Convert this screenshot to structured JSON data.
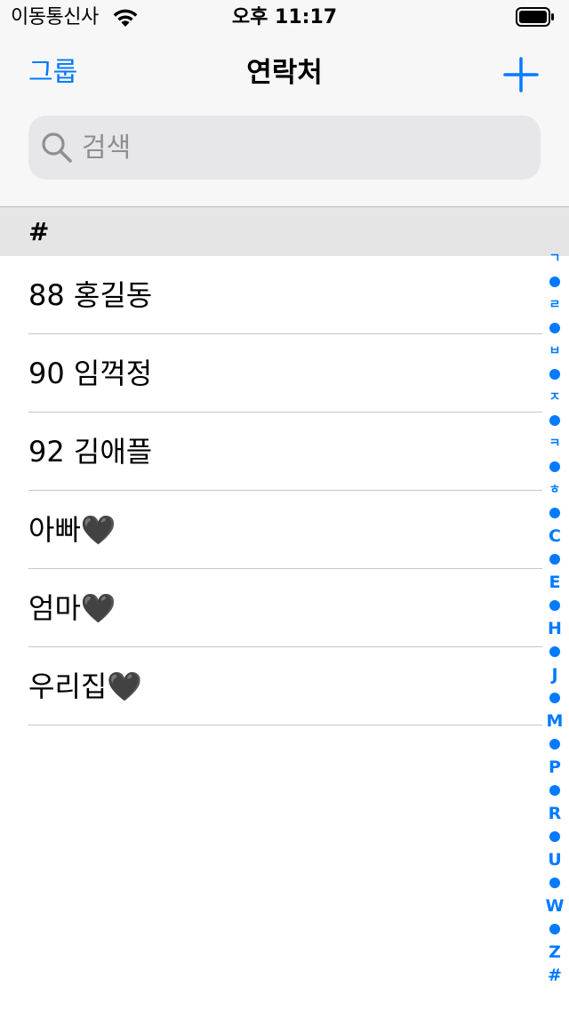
{
  "status_bar": {
    "carrier": "이동통신사",
    "time": "오후 11:17"
  },
  "nav": {
    "left_label": "그룹",
    "title": "연락처"
  },
  "search": {
    "placeholder": "검색"
  },
  "section": {
    "header": "#"
  },
  "contacts": [
    "88 홍길동",
    "90 임꺽정",
    "92 김애플",
    "아빠🖤",
    "엄마🖤",
    "우리집🖤"
  ],
  "index_bar": [
    "ㄱ",
    "•",
    "ㄹ",
    "•",
    "ㅂ",
    "•",
    "ㅈ",
    "•",
    "ㅋ",
    "•",
    "ㅎ",
    "•",
    "C",
    "•",
    "E",
    "•",
    "H",
    "•",
    "J",
    "•",
    "M",
    "•",
    "P",
    "•",
    "R",
    "•",
    "U",
    "•",
    "W",
    "•",
    "Z",
    "#"
  ],
  "colors": {
    "accent": "#007aff",
    "header_bg": "#f7f7f7",
    "section_bg": "#e5e5e5",
    "search_bg": "#e7e7e9"
  }
}
